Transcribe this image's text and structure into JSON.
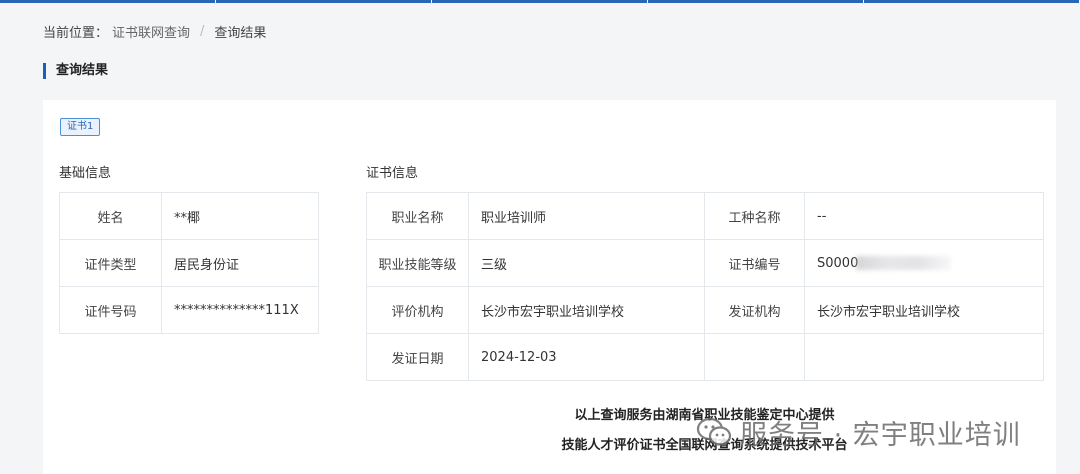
{
  "breadcrumb": {
    "prefix": "当前位置：",
    "link": "证书联网查询",
    "separator": "/",
    "current": "查询结果"
  },
  "section_title": "查询结果",
  "cert_tab": "证书1",
  "basic_info": {
    "title": "基础信息",
    "rows": [
      {
        "label": "姓名",
        "value": "**椰"
      },
      {
        "label": "证件类型",
        "value": "居民身份证"
      },
      {
        "label": "证件号码",
        "value": "**************111X"
      }
    ]
  },
  "cert_info": {
    "title": "证书信息",
    "occupation_label": "职业名称",
    "occupation_value": "职业培训师",
    "job_type_label": "工种名称",
    "job_type_value": "--",
    "level_label": "职业技能等级",
    "level_value": "三级",
    "cert_no_label": "证书编号",
    "cert_no_value": "S0000",
    "eval_org_label": "评价机构",
    "eval_org_value": "长沙市宏宇职业培训学校",
    "issuer_label": "发证机构",
    "issuer_value": "长沙市宏宇职业培训学校",
    "issue_date_label": "发证日期",
    "issue_date_value": "2024-12-03"
  },
  "footer": {
    "line1": "以上查询服务由湖南省职业技能鉴定中心提供",
    "line2": "技能人才评价证书全国联网查询系统提供技术平台"
  },
  "watermark": {
    "text": "服务号 · 宏宇职业培训",
    "icon": "wechat-icon"
  },
  "colors": {
    "accent": "#1f5fb3",
    "tag_border": "#4a90d9",
    "tag_bg": "#eaf3fd"
  }
}
